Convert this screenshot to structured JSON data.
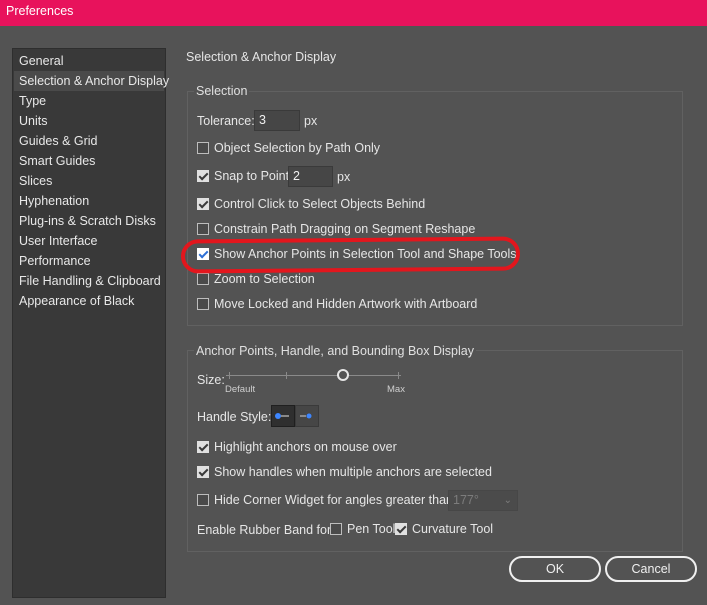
{
  "window": {
    "title": "Preferences",
    "accent": "#e8125c"
  },
  "sidebar": {
    "items": [
      {
        "label": "General"
      },
      {
        "label": "Selection & Anchor Display",
        "selected": true
      },
      {
        "label": "Type"
      },
      {
        "label": "Units"
      },
      {
        "label": "Guides & Grid"
      },
      {
        "label": "Smart Guides"
      },
      {
        "label": "Slices"
      },
      {
        "label": "Hyphenation"
      },
      {
        "label": "Plug-ins & Scratch Disks"
      },
      {
        "label": "User Interface"
      },
      {
        "label": "Performance"
      },
      {
        "label": "File Handling & Clipboard"
      },
      {
        "label": "Appearance of Black"
      }
    ]
  },
  "pane": {
    "title": "Selection & Anchor Display"
  },
  "selection": {
    "group_title": "Selection",
    "tolerance_label": "Tolerance:",
    "tolerance_value": "3",
    "tolerance_unit": "px",
    "object_selection_by_path": {
      "label": "Object Selection by Path Only",
      "checked": false
    },
    "snap_to_point": {
      "label": "Snap to Point",
      "checked": true,
      "value": "2",
      "unit": "px"
    },
    "control_click": {
      "label": "Control Click to Select Objects Behind",
      "checked": true
    },
    "constrain_path": {
      "label": "Constrain Path Dragging on Segment Reshape",
      "checked": false
    },
    "show_anchor_points": {
      "label": "Show Anchor Points in Selection Tool and Shape Tools",
      "checked": true,
      "highlight_color": "#e3161d"
    },
    "zoom_to_selection": {
      "label": "Zoom to Selection",
      "checked": false
    },
    "move_locked": {
      "label": "Move Locked and Hidden Artwork with Artboard",
      "checked": false
    }
  },
  "anchor_display": {
    "group_title": "Anchor Points, Handle, and Bounding Box Display",
    "size_label": "Size:",
    "size_min_label": "Default",
    "size_max_label": "Max",
    "size_value_fraction": 0.67,
    "handle_style_label": "Handle Style:",
    "highlight_anchors": {
      "label": "Highlight anchors on mouse over",
      "checked": true
    },
    "show_handles": {
      "label": "Show handles when multiple anchors are selected",
      "checked": true
    },
    "hide_corner_widget": {
      "label": "Hide Corner Widget for angles greater than:",
      "checked": false,
      "value": "177°"
    },
    "rubber_band_label": "Enable Rubber Band for:",
    "pen_tool": {
      "label": "Pen Tool",
      "checked": false
    },
    "curvature_tool": {
      "label": "Curvature Tool",
      "checked": true
    }
  },
  "buttons": {
    "ok": "OK",
    "cancel": "Cancel"
  }
}
